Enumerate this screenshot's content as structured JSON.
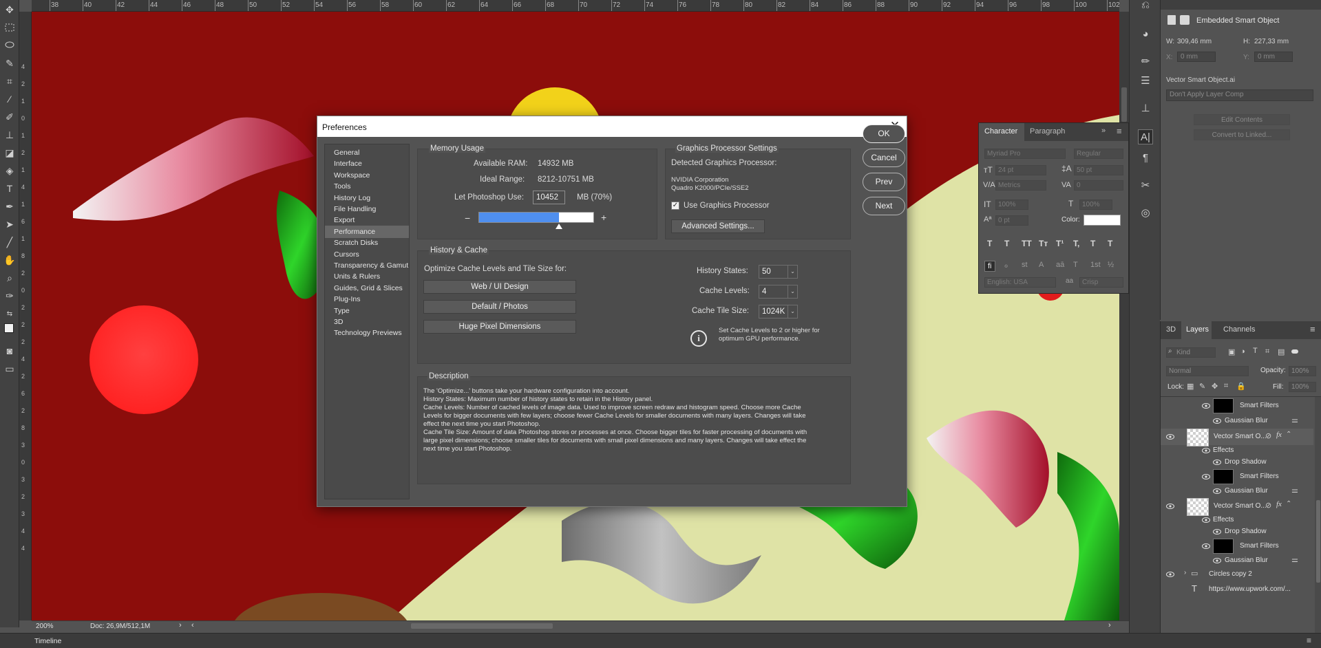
{
  "ruler_top": [
    "38",
    "40",
    "42",
    "44",
    "46",
    "48",
    "50",
    "52",
    "54",
    "56",
    "58",
    "60",
    "62",
    "64",
    "66",
    "68",
    "70",
    "72",
    "74",
    "76",
    "78",
    "80",
    "82",
    "84",
    "86",
    "88",
    "90",
    "92",
    "94",
    "96",
    "98",
    "100",
    "102"
  ],
  "ruler_left": [
    "4",
    "2",
    "1",
    "0",
    "1",
    "2",
    "1",
    "4",
    "1",
    "6",
    "1",
    "8",
    "2",
    "0",
    "2",
    "2",
    "2",
    "4",
    "2",
    "6",
    "2",
    "8",
    "3",
    "0",
    "3",
    "2",
    "3",
    "4",
    "4"
  ],
  "status": {
    "zoom": "200%",
    "doc": "Doc: 26,9M/512,1M"
  },
  "timeline": {
    "label": "Timeline"
  },
  "properties": {
    "object_type": "Embedded Smart Object",
    "w_label": "W:",
    "w_value": "309,46 mm",
    "h_label": "H:",
    "h_value": "227,33 mm",
    "x_label": "X:",
    "x_value": "0 mm",
    "y_label": "Y:",
    "y_value": "0 mm",
    "file_name": "Vector Smart Object.ai",
    "layer_comp": "Don't Apply Layer Comp",
    "edit_contents": "Edit Contents",
    "convert_linked": "Convert to Linked..."
  },
  "character": {
    "tab_character": "Character",
    "tab_paragraph": "Paragraph",
    "font_family": "Myriad Pro",
    "font_style": "Regular",
    "font_size": "24 pt",
    "leading": "50 pt",
    "kerning": "Metrics",
    "tracking": "0",
    "vertical_scale": "100%",
    "horizontal_scale": "100%",
    "baseline": "0 pt",
    "color_label": "Color:",
    "language": "English: USA",
    "aa_label": "aa",
    "antialias": "Crisp",
    "type_buttons": [
      "T",
      "T",
      "TT",
      "Tт",
      "T¹",
      "T,",
      "T",
      "T"
    ],
    "opentype_buttons": [
      "fi",
      "ℴ",
      "st",
      "A",
      "aā",
      "T",
      "1st",
      "½"
    ]
  },
  "layers": {
    "tab_3d": "3D",
    "tab_layers": "Layers",
    "tab_channels": "Channels",
    "kind": "Kind",
    "blend_mode": "Normal",
    "opacity_label": "Opacity:",
    "opacity_value": "100%",
    "lock_label": "Lock:",
    "fill_label": "Fill:",
    "fill_value": "100%",
    "rows": [
      {
        "label": "Smart Filters"
      },
      {
        "label": "Gaussian Blur"
      },
      {
        "label": "Vector Smart O..."
      },
      {
        "label": "Effects"
      },
      {
        "label": "Drop Shadow"
      },
      {
        "label": "Smart Filters"
      },
      {
        "label": "Gaussian Blur"
      },
      {
        "label": "Vector Smart O..."
      },
      {
        "label": "Effects"
      },
      {
        "label": "Drop Shadow"
      },
      {
        "label": "Smart Filters"
      },
      {
        "label": "Gaussian Blur"
      },
      {
        "label": "Circles copy 2"
      },
      {
        "label": "https://www.upwork.com/..."
      }
    ]
  },
  "dialog": {
    "title": "Preferences",
    "nav": [
      "General",
      "Interface",
      "Workspace",
      "Tools",
      "History Log",
      "File Handling",
      "Export",
      "Performance",
      "Scratch Disks",
      "Cursors",
      "Transparency & Gamut",
      "Units & Rulers",
      "Guides, Grid & Slices",
      "Plug-Ins",
      "Type",
      "3D",
      "Technology Previews"
    ],
    "active_nav": "Performance",
    "memory": {
      "title": "Memory Usage",
      "available_label": "Available RAM:",
      "available_value": "14932 MB",
      "ideal_label": "Ideal Range:",
      "ideal_value": "8212-10751 MB",
      "let_label": "Let Photoshop Use:",
      "let_value": "10452",
      "let_suffix": "MB (70%)",
      "minus": "−",
      "plus": "+",
      "slider_fraction": 0.7
    },
    "gpu": {
      "title": "Graphics Processor Settings",
      "detected_label": "Detected Graphics Processor:",
      "vendor": "NVIDIA Corporation",
      "model": "Quadro K2000/PCIe/SSE2",
      "use_gpu_label": "Use Graphics Processor",
      "use_gpu_checked": true,
      "advanced_button": "Advanced Settings..."
    },
    "history": {
      "title": "History & Cache",
      "optimize_label": "Optimize Cache Levels and Tile Size for:",
      "buttons": [
        "Web / UI Design",
        "Default / Photos",
        "Huge Pixel Dimensions"
      ],
      "history_states_label": "History States:",
      "history_states_value": "50",
      "cache_levels_label": "Cache Levels:",
      "cache_levels_value": "4",
      "tile_size_label": "Cache Tile Size:",
      "tile_size_value": "1024K",
      "info_line1": "Set Cache Levels to 2 or higher for",
      "info_line2": "optimum GPU performance."
    },
    "description": {
      "title": "Description",
      "lines": [
        "The 'Optimize...' buttons take your hardware configuration into account.",
        "History States: Maximum number of history states to retain in the History panel.",
        "Cache Levels: Number of cached levels of image data.  Used to improve screen redraw and histogram speed.  Choose more Cache",
        "Levels for bigger documents with few layers; choose fewer Cache Levels for smaller documents with many layers. Changes will take",
        "effect the next time you start Photoshop.",
        "Cache Tile Size: Amount of data Photoshop stores or processes at once. Choose bigger tiles for faster processing of documents with",
        "large pixel dimensions; choose smaller tiles for documents with small pixel dimensions and many layers. Changes will take effect the",
        "next time you start Photoshop."
      ]
    },
    "buttons": {
      "ok": "OK",
      "cancel": "Cancel",
      "prev": "Prev",
      "next": "Next"
    }
  },
  "colors": {
    "canvas_red": "#8c0d0b",
    "cream": "#dfe3a6",
    "yellow_circle": "#f2d21a",
    "red_circle": "#ff3434",
    "slider_blue": "#4f8fef"
  }
}
